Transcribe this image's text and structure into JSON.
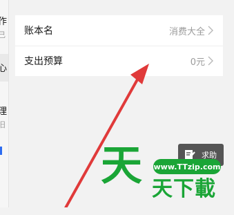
{
  "left_panel": {
    "fragments": [
      "作",
      "己",
      "心",
      "理",
      "旧"
    ]
  },
  "settings": {
    "rows": [
      {
        "label": "账本名",
        "value": "消费大全"
      },
      {
        "label": "支出预算",
        "value": "0元"
      }
    ]
  },
  "help_button": {
    "label": "求助"
  },
  "watermark": {
    "glyph": "天",
    "url": "www.TTzip.com",
    "title": "天下載"
  },
  "colors": {
    "background": "#f2f2f2",
    "card": "#ffffff",
    "arrow": "#e03a3a",
    "watermark": "#1aa536",
    "help_button": "#555555"
  }
}
